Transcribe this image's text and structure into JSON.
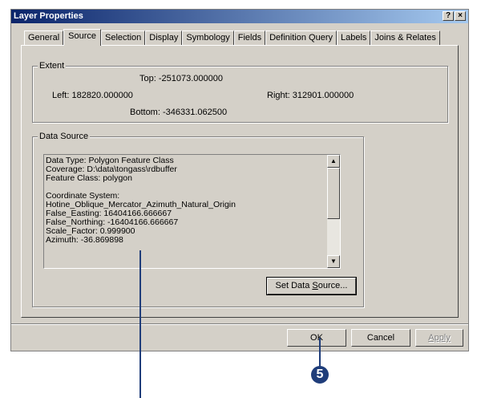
{
  "window": {
    "title": "Layer Properties",
    "help_label": "?",
    "close_label": "×"
  },
  "tabs": [
    "General",
    "Source",
    "Selection",
    "Display",
    "Symbology",
    "Fields",
    "Definition Query",
    "Labels",
    "Joins & Relates"
  ],
  "active_tab": "Source",
  "extent": {
    "title": "Extent",
    "top": "Top:   -251073.000000",
    "left": "Left: 182820.000000",
    "right": "Right: 312901.000000",
    "bottom": "Bottom: -346331.062500"
  },
  "data_source": {
    "title": "Data Source",
    "lines": [
      "Data Type: Polygon Feature Class",
      "Coverage: D:\\data\\tongass\\rdbuffer",
      "Feature Class: polygon",
      "",
      "Coordinate System:",
      "Hotine_Oblique_Mercator_Azimuth_Natural_Origin",
      "False_Easting: 16404166.666667",
      "False_Northing: -16404166.666667",
      "Scale_Factor: 0.999900",
      "Azimuth: -36.869898"
    ],
    "set_button_prefix": "Set Data ",
    "set_button_accel": "S",
    "set_button_suffix": "ource..."
  },
  "buttons": {
    "ok": "OK",
    "cancel": "Cancel",
    "apply": "Apply"
  },
  "callout": {
    "step": "5"
  },
  "colors": {
    "callout": "#1f3d7a",
    "face": "#d4d0c8"
  }
}
